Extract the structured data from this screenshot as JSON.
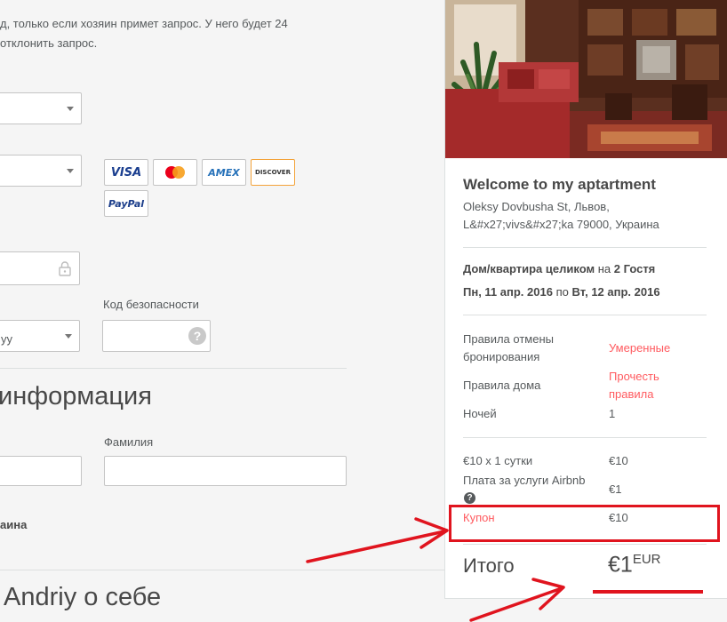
{
  "intro": {
    "line1": "д, только если хозяин примет запрос. У него будет 24",
    "line2": "отклонить запрос."
  },
  "payment": {
    "cards": [
      "VISA",
      "MasterCard",
      "AMEX",
      "DISCOVER",
      "PayPal"
    ],
    "security_code_label": "Код безопасности",
    "expiry_partial": "уy",
    "help_icon": "?"
  },
  "billing": {
    "section_title": "информация",
    "last_name_label": "Фамилия",
    "partial_label": "аина"
  },
  "about": {
    "section_title": "Andriy о себе"
  },
  "summary": {
    "listing_title": "Welcome to my aptartment",
    "address_line1": "Oleksy Dovbusha St, Львов,",
    "address_line2": "L&#x27;vivs&#x27;ka 79000, Украина",
    "room_type": "Дом/квартира целиком",
    "room_for": "на",
    "guests": "2 Гостя",
    "checkin": "Пн, 11 апр. 2016",
    "date_sep": "по",
    "checkout": "Вт, 12 апр. 2016",
    "rules": [
      {
        "label": "Правила отмены бронирования",
        "value": "Умеренные"
      },
      {
        "label": "Правила дома",
        "value": "Прочесть правила"
      },
      {
        "label": "Ночей",
        "value": "1"
      }
    ],
    "price": [
      {
        "label": "€10 x 1 сутки",
        "value": "€10"
      },
      {
        "label": "Плата за услуги Airbnb",
        "value": "€1"
      },
      {
        "label": "Купон",
        "value": "€10"
      }
    ],
    "total_label": "Итого",
    "total_value": "€1",
    "total_currency": "EUR"
  },
  "colors": {
    "accent": "#ff5a5f",
    "annotation_red": "#e0141e",
    "text": "#565a5c",
    "heading": "#484848"
  }
}
